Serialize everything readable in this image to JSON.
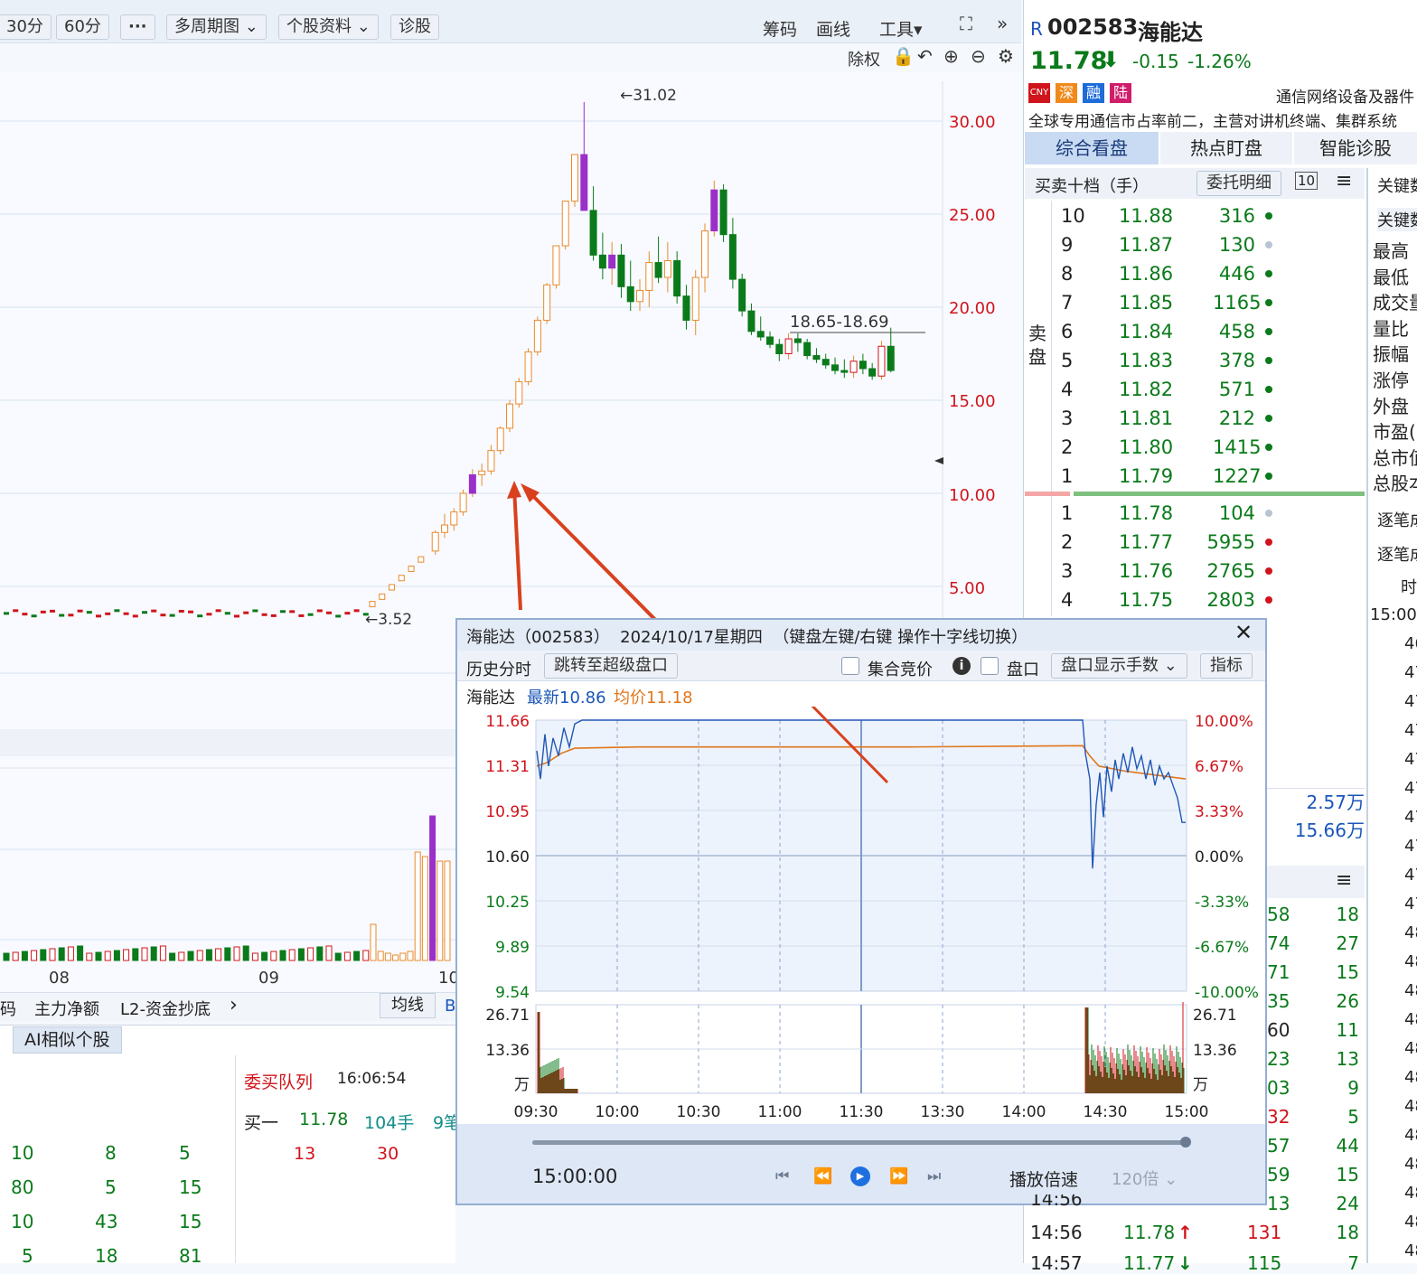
{
  "toolbar": {
    "periods": [
      "30分",
      "60分",
      "···"
    ],
    "multi": "多周期图",
    "profile": "个股资料",
    "diagnose": "诊股",
    "chip": "筹码",
    "draw": "画线",
    "tools": "工具",
    "ex_right": "除权"
  },
  "kline": {
    "y_labels": [
      "30.00",
      "25.00",
      "20.00",
      "15.00",
      "10.00",
      "5.00"
    ],
    "high_label": "←31.02",
    "low_label": "←3.52",
    "range_label": "18.65-18.69",
    "x_labels": [
      "08",
      "09",
      "10"
    ],
    "candles": [
      [
        6.9,
        8.0,
        6.7,
        7.9
      ],
      [
        7.9,
        8.9,
        7.6,
        8.3
      ],
      [
        8.3,
        9.2,
        8.0,
        9.0
      ],
      [
        9.0,
        10.2,
        8.8,
        10.0
      ],
      [
        10.0,
        11.3,
        9.8,
        11.0
      ],
      [
        11.0,
        11.6,
        10.4,
        11.2
      ],
      [
        11.2,
        12.6,
        11.0,
        12.3
      ],
      [
        12.3,
        13.6,
        12.1,
        13.5
      ],
      [
        13.5,
        15.0,
        13.3,
        14.8
      ],
      [
        14.8,
        16.2,
        14.6,
        16.0
      ],
      [
        16.0,
        17.8,
        15.8,
        17.6
      ],
      [
        17.6,
        19.5,
        17.4,
        19.3
      ],
      [
        19.3,
        21.3,
        19.1,
        21.2
      ],
      [
        21.2,
        23.3,
        21.0,
        23.3
      ],
      [
        23.3,
        25.7,
        23.1,
        25.7
      ],
      [
        25.7,
        28.2,
        25.4,
        28.2
      ],
      [
        28.2,
        31.02,
        27.0,
        25.2
      ],
      [
        25.2,
        26.5,
        22.5,
        22.8
      ],
      [
        22.8,
        24.0,
        21.5,
        22.1
      ],
      [
        22.1,
        23.5,
        21.2,
        22.8
      ],
      [
        22.8,
        23.4,
        20.5,
        21.1
      ],
      [
        21.1,
        22.5,
        19.8,
        20.3
      ],
      [
        20.3,
        21.5,
        19.8,
        20.9
      ],
      [
        20.9,
        23.0,
        20.0,
        22.4
      ],
      [
        22.4,
        23.8,
        21.3,
        21.6
      ],
      [
        21.6,
        23.5,
        20.8,
        22.5
      ],
      [
        22.5,
        23.0,
        20.2,
        20.6
      ],
      [
        20.6,
        21.2,
        18.8,
        19.3
      ],
      [
        19.3,
        22.0,
        18.5,
        21.6
      ],
      [
        21.6,
        24.5,
        20.8,
        24.1
      ],
      [
        24.1,
        26.8,
        23.8,
        26.3
      ],
      [
        26.3,
        26.6,
        23.5,
        23.9
      ],
      [
        23.9,
        24.8,
        21.0,
        21.5
      ],
      [
        21.5,
        21.8,
        19.5,
        19.8
      ],
      [
        19.8,
        20.2,
        18.5,
        18.7
      ],
      [
        18.7,
        19.5,
        18.2,
        18.4
      ],
      [
        18.4,
        18.7,
        17.8,
        18.0
      ],
      [
        18.0,
        18.3,
        17.1,
        17.5
      ],
      [
        17.5,
        18.6,
        17.2,
        18.3
      ],
      [
        18.3,
        18.6,
        17.6,
        18.1
      ],
      [
        18.1,
        18.3,
        17.2,
        17.4
      ],
      [
        17.4,
        17.8,
        17.0,
        17.2
      ],
      [
        17.2,
        17.5,
        16.7,
        16.9
      ],
      [
        16.9,
        17.3,
        16.4,
        16.6
      ],
      [
        16.6,
        17.2,
        16.2,
        16.5
      ],
      [
        16.5,
        17.4,
        16.2,
        17.1
      ],
      [
        17.1,
        17.5,
        16.4,
        16.7
      ],
      [
        16.7,
        17.0,
        16.1,
        16.3
      ],
      [
        16.3,
        18.2,
        16.1,
        17.9
      ],
      [
        17.9,
        18.9,
        16.5,
        16.6
      ]
    ]
  },
  "quote": {
    "prefix": "R",
    "code": "002583",
    "name": "海能达",
    "price": "11.78",
    "arrow": "⬇",
    "change": "-0.15",
    "pct": "-1.26%",
    "tags": [
      "CNY",
      "深",
      "融",
      "陆"
    ],
    "industry": "通信网络设备及器件",
    "desc": "全球专用通信市占率前二，主营对讲机终端、集群系统"
  },
  "tabs": [
    "综合看盘",
    "热点盯盘",
    "智能诊股"
  ],
  "book": {
    "title": "买卖十档（手）",
    "detail": "委托明细",
    "ten": "10",
    "sell_label": "卖盘",
    "asks": [
      [
        "10",
        "11.88",
        "316"
      ],
      [
        "9",
        "11.87",
        "130"
      ],
      [
        "8",
        "11.86",
        "446"
      ],
      [
        "7",
        "11.85",
        "1165"
      ],
      [
        "6",
        "11.84",
        "458"
      ],
      [
        "5",
        "11.83",
        "378"
      ],
      [
        "4",
        "11.82",
        "571"
      ],
      [
        "3",
        "11.81",
        "212"
      ],
      [
        "2",
        "11.80",
        "1415"
      ],
      [
        "1",
        "11.79",
        "1227"
      ]
    ],
    "bids": [
      [
        "1",
        "11.78",
        "104"
      ],
      [
        "2",
        "11.77",
        "5955"
      ],
      [
        "3",
        "11.76",
        "2765"
      ],
      [
        "4",
        "11.75",
        "2803"
      ]
    ]
  },
  "keydata": {
    "title": "关键数",
    "sub": "关键数",
    "items": [
      "最高",
      "最低",
      "成交量",
      "量比",
      "振幅",
      "涨停",
      "外盘",
      "市盈(",
      "总市值",
      "总股本"
    ],
    "tick_tab": "逐笔成交",
    "tick_tab2": "逐笔成交",
    "time_col": "时",
    "time0": "15:00:",
    "vals": [
      "46",
      "47",
      "47",
      "47",
      "47",
      "47",
      "47",
      "47",
      "47",
      "47",
      "48",
      "48",
      "48",
      "48",
      "48",
      "48",
      "48",
      "48",
      "48",
      "48",
      "48",
      "48"
    ]
  },
  "midstats": {
    "v1": "2.57万",
    "v2": "15.66万"
  },
  "ticks": {
    "partial": [
      [
        "58",
        "18"
      ],
      [
        "74",
        "27"
      ],
      [
        "71",
        "15"
      ],
      [
        "35",
        "26"
      ],
      [
        "60",
        "11"
      ],
      [
        "23",
        "13"
      ],
      [
        "03",
        "9"
      ],
      [
        "32",
        "5"
      ],
      [
        "57",
        "44"
      ],
      [
        "59",
        "15"
      ],
      [
        "13",
        "24"
      ]
    ],
    "partial_time": "14:56",
    "rows": [
      [
        "14:56",
        "11.78",
        "↑",
        "131",
        "18"
      ],
      [
        "14:57",
        "11.77",
        "↓",
        "115",
        "7"
      ]
    ]
  },
  "bottom": {
    "tabs": [
      "码",
      "主力净额",
      "L2-资金抄底",
      "均线",
      "B"
    ],
    "ai": "AI相似个股",
    "queue_title": "委买队列",
    "queue_time": "16:06:54",
    "buy1": "买一",
    "buy1_price": "11.78",
    "buy1_vol": "104手",
    "buy1_n": "9笔",
    "queue_vals": [
      "13",
      "30"
    ],
    "left_rows": [
      [
        "10",
        "8",
        "5"
      ],
      [
        "80",
        "5",
        "15"
      ],
      [
        "10",
        "43",
        "15"
      ],
      [
        "5",
        "18",
        "81"
      ]
    ]
  },
  "popup": {
    "title": "海能达（002583）  2024/10/17星期四  （键盘左键/右键 操作十字线切换）",
    "close": "✕",
    "hist": "历史分时",
    "jump": "跳转至超级盘口",
    "auction": "集合竞价",
    "info": "i",
    "pankou": "盘口",
    "show_hands": "盘口显示手数",
    "index": "指标",
    "name": "海能达",
    "latest": "最新10.86",
    "avg": "均价11.18",
    "left_axis": [
      "11.66",
      "11.31",
      "10.95",
      "10.60",
      "10.25",
      "9.89",
      "9.54"
    ],
    "right_axis": [
      "10.00%",
      "6.67%",
      "3.33%",
      "0.00%",
      "-3.33%",
      "-6.67%",
      "-10.00%"
    ],
    "vol_axis": [
      "26.71",
      "13.36",
      "万"
    ],
    "times": [
      "09:30",
      "10:00",
      "10:30",
      "11:00",
      "11:30",
      "13:30",
      "14:00",
      "14:30",
      "15:00"
    ],
    "clock": "15:00:00",
    "speed_label": "播放倍速",
    "speed": "120倍"
  },
  "colors": {
    "up": "#d0141b",
    "down": "#0a7a1a",
    "candle_up": "#e98a2c",
    "limit": "#9b30c9",
    "accent": "#1a56b8"
  }
}
